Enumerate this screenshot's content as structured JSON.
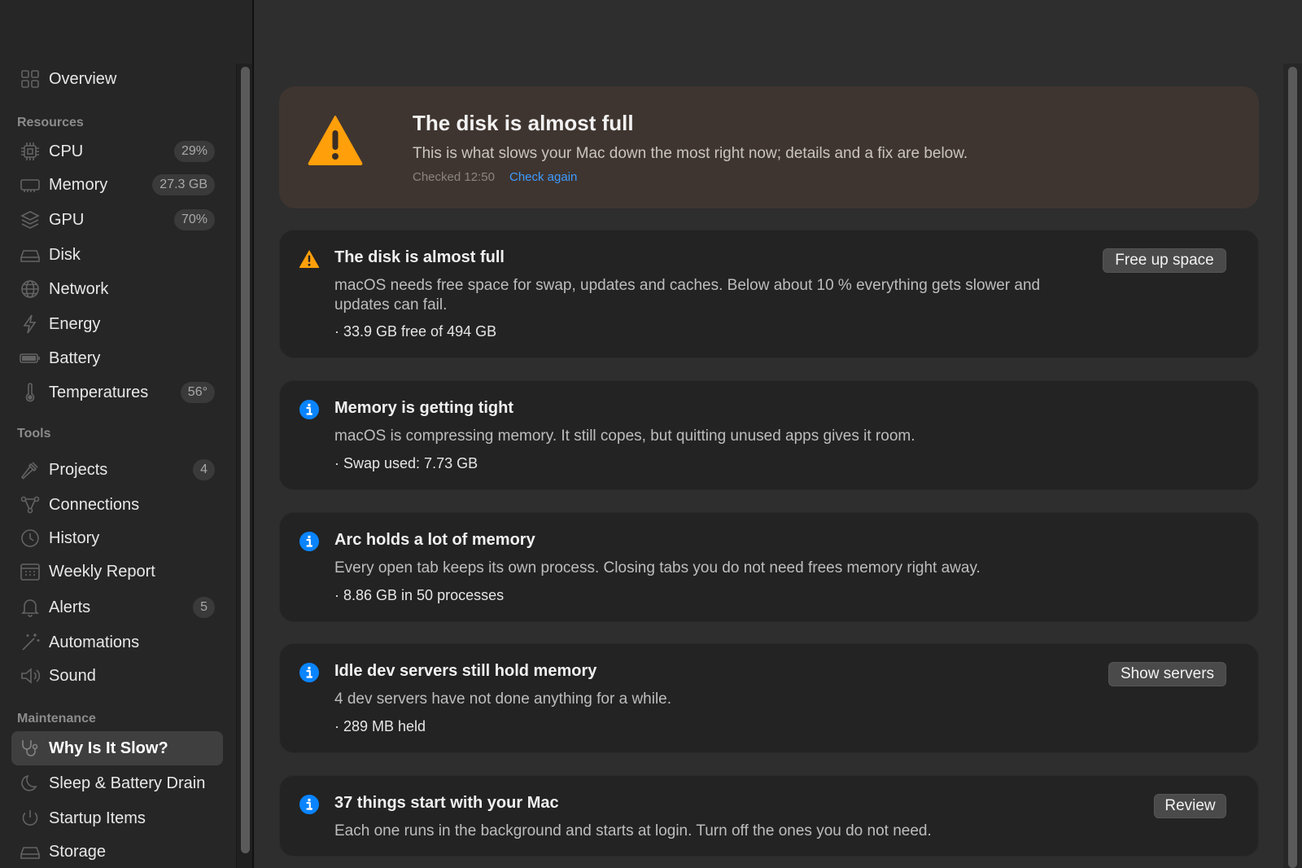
{
  "sidebar": {
    "overview": {
      "label": "Overview",
      "icon": "grid-icon"
    },
    "sections": {
      "resources": "Resources",
      "tools": "Tools",
      "maintenance": "Maintenance"
    },
    "resources": [
      {
        "label": "CPU",
        "badge": "29%",
        "icon": "chip-icon"
      },
      {
        "label": "Memory",
        "badge": "27.3 GB",
        "icon": "memory-icon"
      },
      {
        "label": "GPU",
        "badge": "70%",
        "icon": "layers-icon"
      },
      {
        "label": "Disk",
        "badge": "",
        "icon": "disk-icon"
      },
      {
        "label": "Network",
        "badge": "",
        "icon": "globe-icon"
      },
      {
        "label": "Energy",
        "badge": "",
        "icon": "bolt-icon"
      },
      {
        "label": "Battery",
        "badge": "",
        "icon": "battery-icon"
      },
      {
        "label": "Temperatures",
        "badge": "56°",
        "icon": "thermometer-icon"
      }
    ],
    "tools": [
      {
        "label": "Projects",
        "badge": "4",
        "icon": "hammer-icon"
      },
      {
        "label": "Connections",
        "badge": "",
        "icon": "network-nodes-icon"
      },
      {
        "label": "History",
        "badge": "",
        "icon": "clock-icon"
      },
      {
        "label": "Weekly Report",
        "badge": "",
        "icon": "calendar-icon"
      },
      {
        "label": "Alerts",
        "badge": "5",
        "icon": "bell-icon"
      },
      {
        "label": "Automations",
        "badge": "",
        "icon": "wand-icon"
      },
      {
        "label": "Sound",
        "badge": "",
        "icon": "speaker-icon"
      }
    ],
    "maintenance": [
      {
        "label": "Why Is It Slow?",
        "badge": "",
        "icon": "stethoscope-icon",
        "selected": true
      },
      {
        "label": "Sleep & Battery Drain",
        "badge": "",
        "icon": "moon-icon"
      },
      {
        "label": "Startup Items",
        "badge": "",
        "icon": "power-icon"
      },
      {
        "label": "Storage",
        "badge": "",
        "icon": "drive-icon"
      }
    ]
  },
  "hero": {
    "title": "The disk is almost full",
    "subtitle": "This is what slows your Mac down the most right now; details and a fix are below.",
    "checked": "Checked 12:50",
    "check_again": "Check again",
    "icon": "warning-icon"
  },
  "cards": [
    {
      "icon": "warning-icon",
      "title": "The disk is almost full",
      "body": "macOS needs free space for swap, updates and caches. Below about 10 % everything gets slower and updates can fail.",
      "detail": "· 33.9 GB free of 494 GB",
      "button": "Free up space"
    },
    {
      "icon": "info-icon",
      "title": "Memory is getting tight",
      "body": "macOS is compressing memory. It still copes, but quitting unused apps gives it room.",
      "detail": "· Swap used: 7.73 GB",
      "button": ""
    },
    {
      "icon": "info-icon",
      "title": "Arc holds a lot of memory",
      "body": "Every open tab keeps its own process. Closing tabs you do not need frees memory right away.",
      "detail": "· 8.86 GB in 50 processes",
      "button": ""
    },
    {
      "icon": "info-icon",
      "title": "Idle dev servers still hold memory",
      "body": "4 dev servers have not done anything for a while.",
      "detail": "· 289 MB held",
      "button": "Show servers"
    },
    {
      "icon": "info-icon",
      "title": "37 things start with your Mac",
      "body": "Each one runs in the background and starts at login. Turn off the ones you do not need.",
      "detail": "",
      "button": "Review"
    }
  ],
  "colors": {
    "accent_link": "#3d9bff",
    "warning": "#ff9f0a",
    "info": "#0a84ff"
  }
}
